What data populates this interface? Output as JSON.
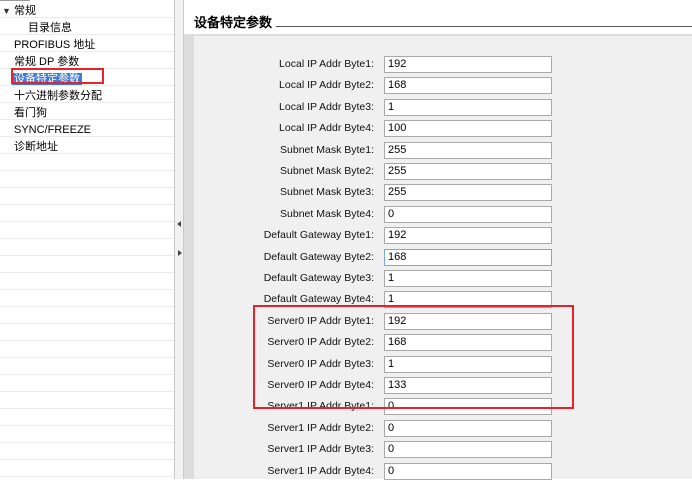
{
  "nav": {
    "root": "常规",
    "items": [
      {
        "label": "目录信息",
        "indent": true,
        "selected": false
      },
      {
        "label": "PROFIBUS 地址",
        "indent": false,
        "selected": false
      },
      {
        "label": "常规 DP 参数",
        "indent": false,
        "selected": false
      },
      {
        "label": "设备特定参数",
        "indent": false,
        "selected": true
      },
      {
        "label": "十六进制参数分配",
        "indent": false,
        "selected": false
      },
      {
        "label": "看门狗",
        "indent": false,
        "selected": false
      },
      {
        "label": "SYNC/FREEZE",
        "indent": false,
        "selected": false
      },
      {
        "label": "诊断地址",
        "indent": false,
        "selected": false
      }
    ]
  },
  "main": {
    "title": "设备特定参数",
    "params": [
      {
        "label": "Local IP Addr Byte1:",
        "value": "192"
      },
      {
        "label": "Local IP Addr Byte2:",
        "value": "168"
      },
      {
        "label": "Local IP Addr Byte3:",
        "value": "1"
      },
      {
        "label": "Local IP Addr Byte4:",
        "value": "100"
      },
      {
        "label": "Subnet Mask Byte1:",
        "value": "255"
      },
      {
        "label": "Subnet Mask Byte2:",
        "value": "255"
      },
      {
        "label": "Subnet Mask Byte3:",
        "value": "255"
      },
      {
        "label": "Subnet Mask Byte4:",
        "value": "0"
      },
      {
        "label": "Default Gateway Byte1:",
        "value": "192"
      },
      {
        "label": "Default Gateway Byte2:",
        "value": "168"
      },
      {
        "label": "Default Gateway Byte3:",
        "value": "1"
      },
      {
        "label": "Default Gateway Byte4:",
        "value": "1"
      },
      {
        "label": "Server0 IP Addr Byte1:",
        "value": "192"
      },
      {
        "label": "Server0 IP Addr Byte2:",
        "value": "168"
      },
      {
        "label": "Server0 IP Addr Byte3:",
        "value": "1"
      },
      {
        "label": "Server0 IP Addr Byte4:",
        "value": "133"
      },
      {
        "label": "Server1 IP Addr Byte1:",
        "value": "0"
      },
      {
        "label": "Server1 IP Addr Byte2:",
        "value": "0"
      },
      {
        "label": "Server1 IP Addr Byte3:",
        "value": "0"
      },
      {
        "label": "Server1 IP Addr Byte4:",
        "value": "0"
      }
    ]
  },
  "colors": {
    "highlight": "#e8212a",
    "selection": "#3d7bd6",
    "panel_bg": "#f0f0f0"
  }
}
